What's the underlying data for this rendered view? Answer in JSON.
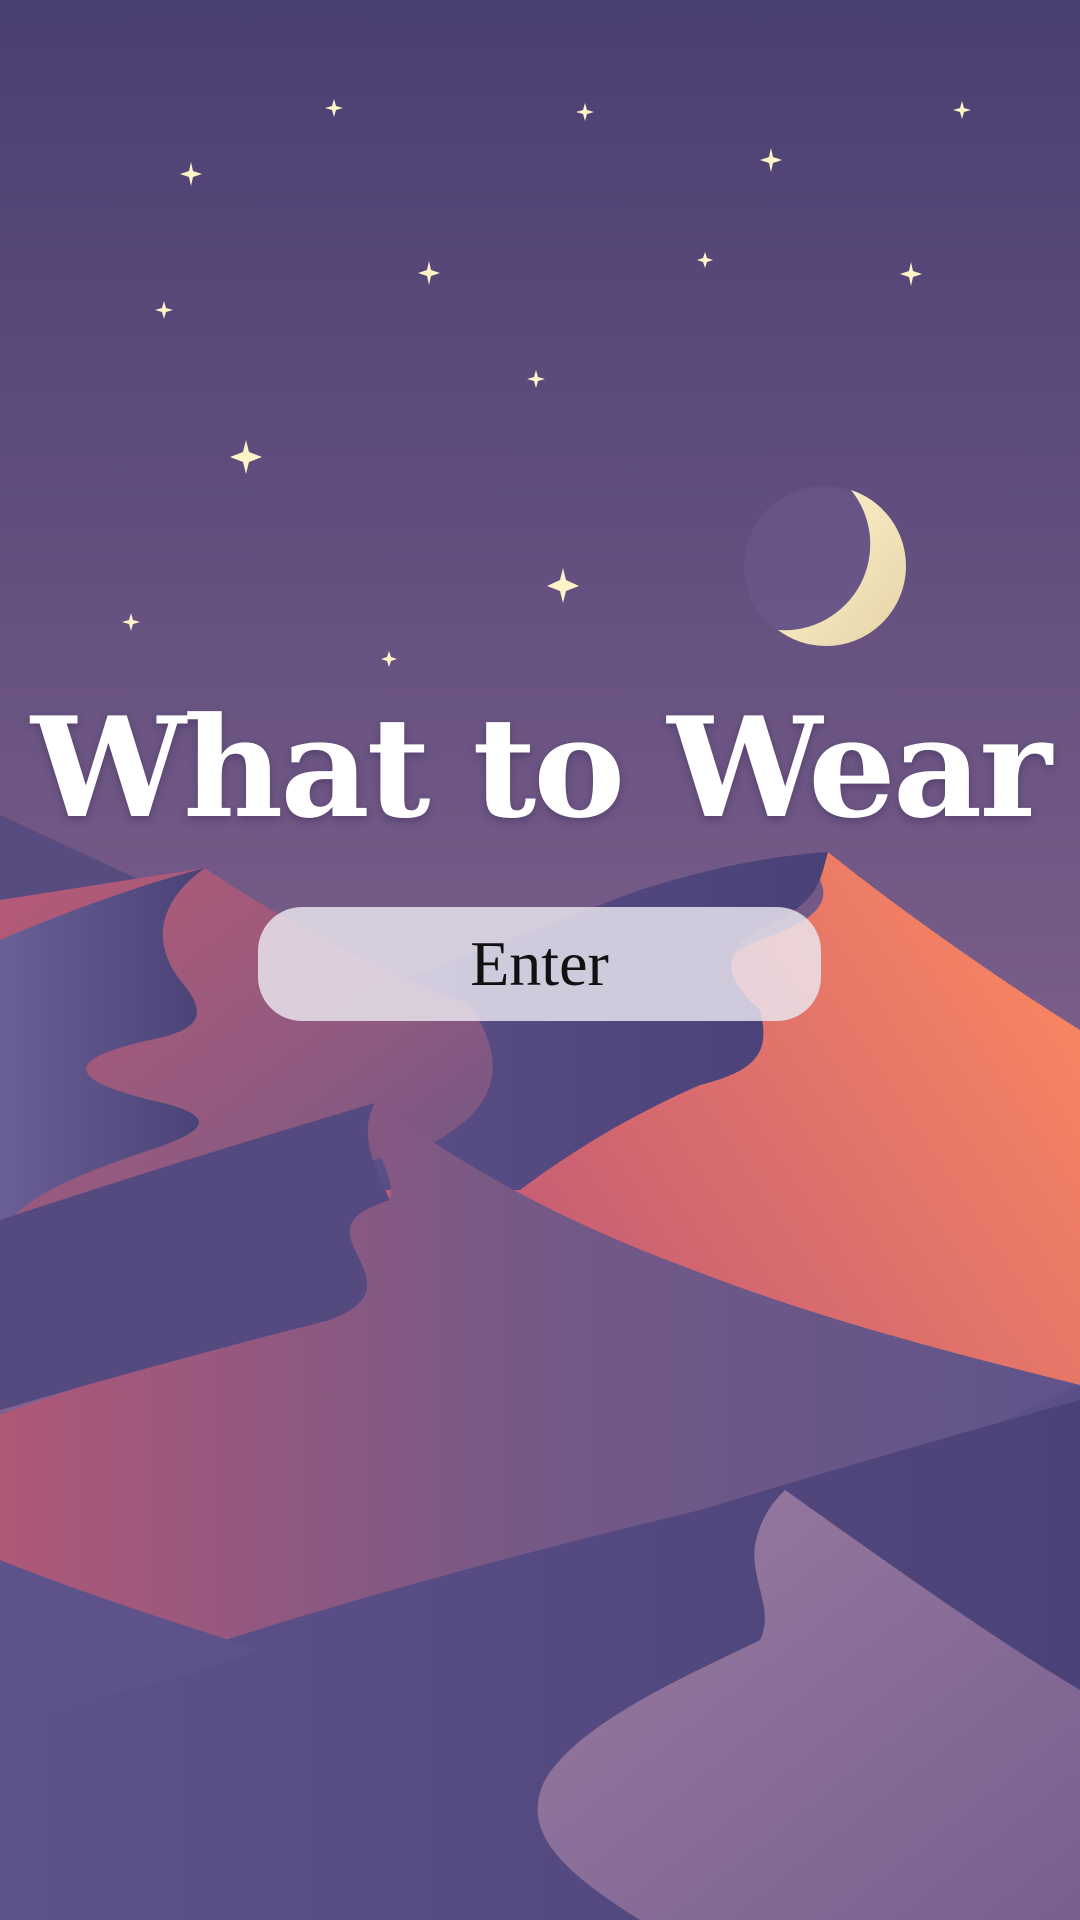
{
  "app": {
    "title": "What to Wear"
  },
  "enter_button": {
    "label": "Enter"
  },
  "scene": {
    "icons": [
      "stars",
      "crescent-moon-icon",
      "desert-dunes"
    ],
    "colors": {
      "sky_top": "#4a3f72",
      "sky_bottom": "#8a6790",
      "dune_orange": "#f0866a",
      "dune_rose": "#b35c78",
      "dune_violet": "#5f5489",
      "dune_dark": "#4b4277",
      "dune_lilac": "#987a9d",
      "star": "#fff3c8",
      "moon": "#f1e3b6",
      "title_text": "#ffffff"
    }
  }
}
